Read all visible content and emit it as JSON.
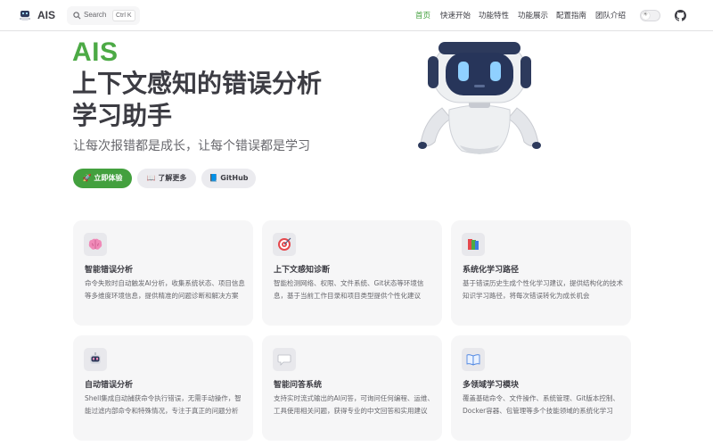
{
  "header": {
    "site_title": "AIS",
    "search": {
      "label": "Search",
      "shortcut": "Ctrl K"
    },
    "nav": [
      {
        "label": "首页",
        "active": true
      },
      {
        "label": "快速开始",
        "active": false
      },
      {
        "label": "功能特性",
        "active": false
      },
      {
        "label": "功能展示",
        "active": false
      },
      {
        "label": "配置指南",
        "active": false
      },
      {
        "label": "团队介绍",
        "active": false
      }
    ],
    "theme_toggle_icon": "sun-icon",
    "github_icon": "github-icon"
  },
  "hero": {
    "name": "AIS",
    "title_line1": "上下文感知的错误分析",
    "title_line2": "学习助手",
    "tagline": "让每次报错都是成长，让每个错误都是学习",
    "buttons": {
      "primary": "🚀 立即体验",
      "more": "📖 了解更多",
      "github": "📘 GitHub"
    }
  },
  "features": [
    {
      "icon": "brain-icon",
      "title": "智能错误分析",
      "desc": "命令失败时自动触发AI分析，收集系统状态、项目信息等多维度环境信息，提供精准的问题诊断和解决方案"
    },
    {
      "icon": "target-icon",
      "title": "上下文感知诊断",
      "desc": "智能检测网络、权限、文件系统、Git状态等环境信息，基于当前工作目录和项目类型提供个性化建议"
    },
    {
      "icon": "books-icon",
      "title": "系统化学习路径",
      "desc": "基于错误历史生成个性化学习建议，提供结构化的技术知识学习路径，将每次错误转化为成长机会"
    },
    {
      "icon": "robot-icon",
      "title": "自动错误分析",
      "desc": "Shell集成自动捕获命令执行错误，无需手动操作，智能过滤内部命令和特殊情况，专注于真正的问题分析"
    },
    {
      "icon": "speech-bubble-icon",
      "title": "智能问答系统",
      "desc": "支持实时流式输出的AI问答，可询问任何编程、运维、工具使用相关问题，获得专业的中文回答和实用建议"
    },
    {
      "icon": "open-book-icon",
      "title": "多领域学习模块",
      "desc": "覆盖基础命令、文件操作、系统管理、Git版本控制、Docker容器、包管理等多个技能领域的系统化学习"
    }
  ],
  "colors": {
    "brand": "#43a03e",
    "text": "#3c3c43",
    "muted": "#67676c",
    "card_bg": "#f6f6f7"
  }
}
